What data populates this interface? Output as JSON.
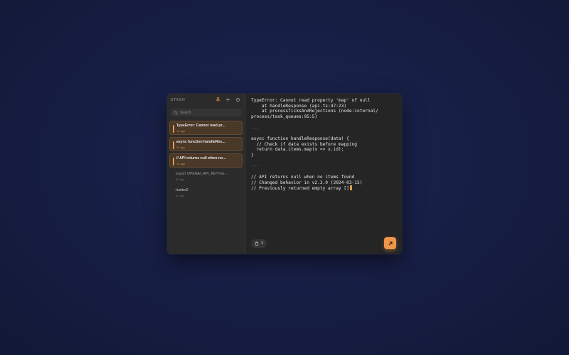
{
  "sidebar": {
    "brand": "STASH",
    "search_placeholder": "Search",
    "items": [
      {
        "title": "TypeError: Cannot read pr...",
        "time": "1h ago",
        "pinned": true
      },
      {
        "title": "async function handleRes...",
        "time": "2h ago",
        "pinned": true
      },
      {
        "title": "// API returns null when no...",
        "time": "1h ago",
        "pinned": true
      },
      {
        "title": "export OPENAI_API_KEY=sk-...",
        "time": "3h ago",
        "pinned": false
      },
      {
        "title": "hunter2",
        "time": "1d ago",
        "pinned": false
      }
    ]
  },
  "editor": {
    "lines": [
      "TypeError: Cannot read property 'map' of null",
      "    at handleResponse (api.ts:47:23)",
      "    at processTicksAndRejections (node:internal/",
      "process/task_queues:95:5)",
      "",
      "---",
      "",
      "async function handleResponse(data) {",
      "  // Check if data exists before mapping",
      "  return data.items.map(x => x.id);",
      "}",
      "",
      "---",
      "",
      "// API returns null when no items found",
      "// Changed behavior in v2.3.0 (2024-03-15)",
      "// Previously returned empty array []"
    ]
  },
  "footer": {
    "clip_count": "3"
  },
  "colors": {
    "accent": "#f0964a",
    "background": "#161d42"
  }
}
